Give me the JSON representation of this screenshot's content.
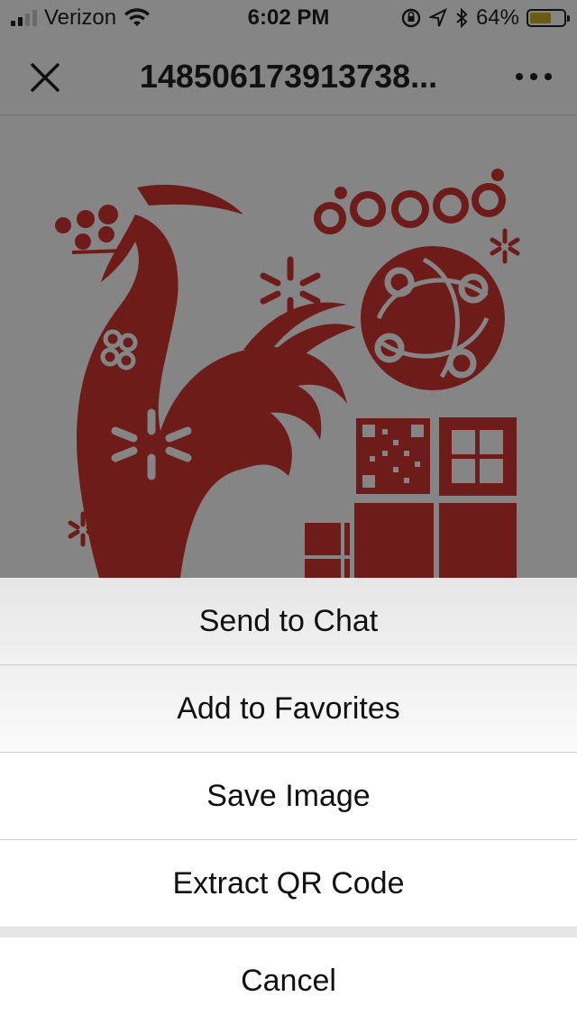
{
  "status_bar": {
    "carrier": "Verizon",
    "time": "6:02 PM",
    "battery": "64%",
    "battery_level": 0.64,
    "icons": [
      "signal-icon",
      "wifi-icon",
      "orientation-lock-icon",
      "location-icon",
      "bluetooth-icon",
      "battery-icon"
    ]
  },
  "nav": {
    "title": "148506173913738...",
    "close_icon": "close-icon",
    "more_icon": "more-icon"
  },
  "artwork": {
    "colors": {
      "red": "#6e1c1a",
      "background": "#858585"
    }
  },
  "action_sheet": {
    "items": [
      {
        "label": "Send to Chat"
      },
      {
        "label": "Add to Favorites"
      },
      {
        "label": "Save Image"
      },
      {
        "label": "Extract QR Code"
      }
    ],
    "cancel_label": "Cancel"
  }
}
